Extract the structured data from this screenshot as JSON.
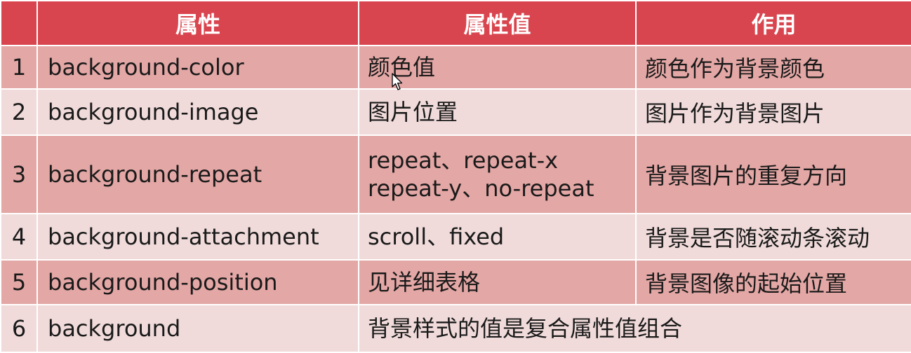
{
  "header": {
    "col_property": "属性",
    "col_value": "属性值",
    "col_effect": "作用"
  },
  "rows": [
    {
      "num": "1",
      "property": "background-color",
      "value": [
        "颜色值"
      ],
      "effect": "颜色作为背景颜色"
    },
    {
      "num": "2",
      "property": "background-image",
      "value": [
        "图片位置"
      ],
      "effect": "图片作为背景图片"
    },
    {
      "num": "3",
      "property": "background-repeat",
      "value": [
        "repeat、repeat-x",
        "repeat-y、no-repeat"
      ],
      "effect": "背景图片的重复方向"
    },
    {
      "num": "4",
      "property": "background-attachment",
      "value": [
        "scroll、fixed"
      ],
      "effect": "背景是否随滚动条滚动"
    },
    {
      "num": "5",
      "property": "background-position",
      "value": [
        "见详细表格"
      ],
      "effect": "背景图像的起始位置"
    },
    {
      "num": "6",
      "property": "background",
      "value": [
        "背景样式的值是复合属性值组合"
      ],
      "effect": ""
    }
  ],
  "colors": {
    "header_bg": "#d9454f",
    "row_odd_bg": "#e3a7a5",
    "row_even_bg": "#f0dbda",
    "text": "#1a1a1a"
  }
}
